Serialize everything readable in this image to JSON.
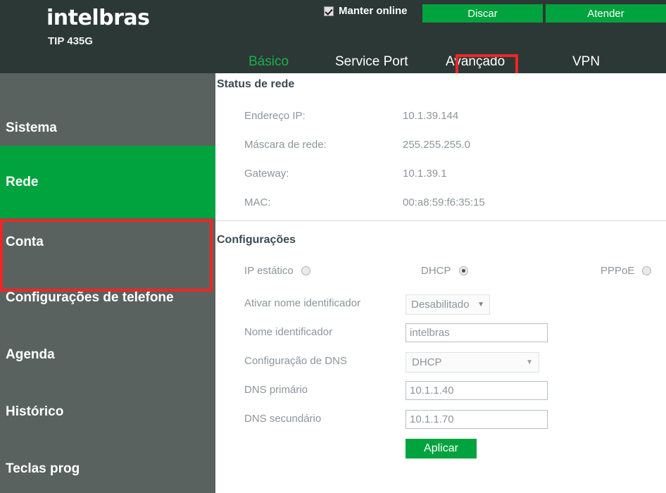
{
  "brand": {
    "logo": "intelbras",
    "model": "TIP 435G"
  },
  "topbar": {
    "keep_online_label": "Manter online",
    "keep_online_checked": true,
    "dial_label": "Discar",
    "answer_label": "Atender",
    "button_color": "#00a33e"
  },
  "tabs": {
    "active": "Básico",
    "highlight_color": "#ef2626",
    "active_color": "#19b04a",
    "items": [
      {
        "label": "Básico"
      },
      {
        "label": "Service Port"
      },
      {
        "label": "Avançado"
      },
      {
        "label": "VPN"
      }
    ]
  },
  "sidebar": {
    "active": "Rede",
    "active_bg": "#00a33e",
    "highlight_color": "#ef2626",
    "items": [
      {
        "label": "Sistema"
      },
      {
        "label": "Rede"
      },
      {
        "label": "Conta"
      },
      {
        "label": "Configurações de telefone"
      },
      {
        "label": "Agenda"
      },
      {
        "label": "Histórico"
      },
      {
        "label": "Teclas prog"
      }
    ]
  },
  "main": {
    "status_section": {
      "title": "Status de rede",
      "rows": [
        {
          "label": "Endereço IP:",
          "value": "10.1.39.144"
        },
        {
          "label": "Máscara de rede:",
          "value": "255.255.255.0"
        },
        {
          "label": "Gateway:",
          "value": "10.1.39.1"
        },
        {
          "label": "MAC:",
          "value": "00:a8:59:f6:35:15"
        }
      ]
    },
    "config_section": {
      "title": "Configurações",
      "mode_options": [
        {
          "label": "IP estático",
          "selected": false
        },
        {
          "label": "DHCP",
          "selected": true
        },
        {
          "label": "PPPoE",
          "selected": false
        }
      ],
      "fields": [
        {
          "label": "Ativar nome identificador",
          "type": "select",
          "value": "Desabilitado"
        },
        {
          "label": "Nome identificador",
          "type": "text",
          "value": "intelbras",
          "placeholder": ""
        },
        {
          "label": "Configuração de DNS",
          "type": "select",
          "value": "DHCP"
        },
        {
          "label": "DNS primário",
          "type": "text",
          "value": "10.1.1.40",
          "placeholder": ""
        },
        {
          "label": "DNS secundário",
          "type": "text",
          "value": "10.1.1.70",
          "placeholder": ""
        }
      ],
      "apply_label": "Aplicar"
    }
  }
}
